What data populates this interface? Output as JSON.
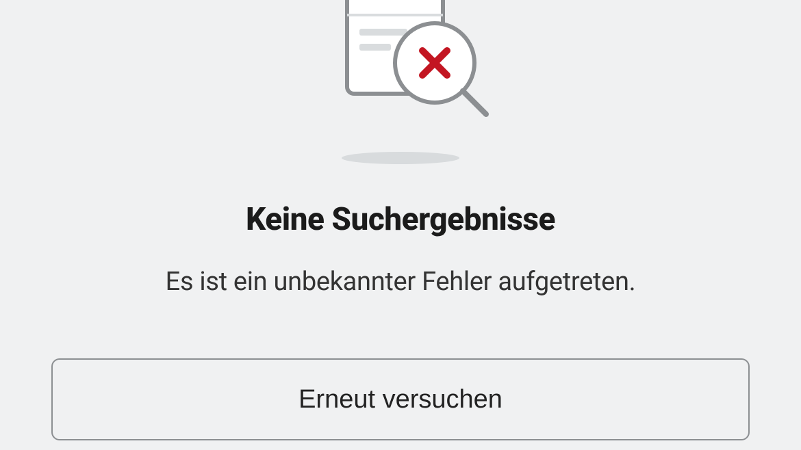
{
  "error": {
    "heading": "Keine Suchergebnisse",
    "subtext": "Es ist ein unbekannter Fehler aufgetreten.",
    "retry_label": "Erneut versuchen"
  },
  "colors": {
    "accent_red": "#c31622"
  }
}
